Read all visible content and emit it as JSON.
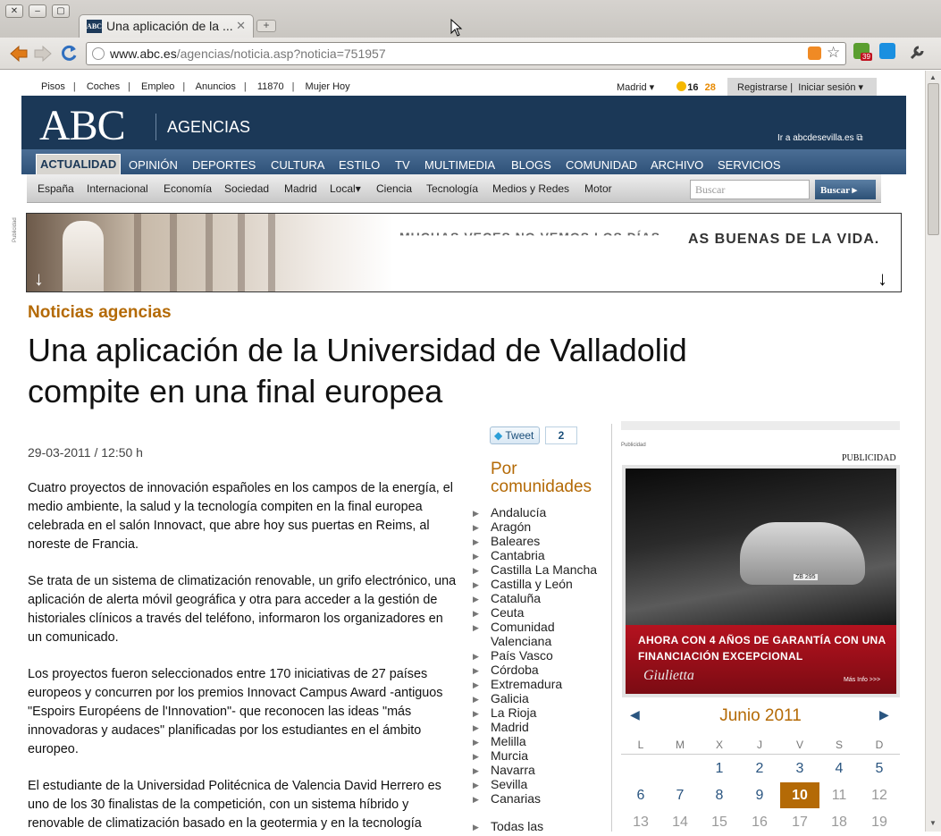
{
  "browser": {
    "tab_title": "Una aplicación de la ...",
    "tab_favicon": "ABC",
    "url_domain": "www.abc.es",
    "url_path": "/agencias/noticia.asp?noticia=751957",
    "extension_badge": "39"
  },
  "topnav": {
    "links": [
      "Pisos",
      "Coches",
      "Empleo",
      "Anuncios",
      "11870",
      "Mujer Hoy"
    ],
    "city": "Madrid ▾",
    "temp_low": "16",
    "temp_high": "28",
    "register": "Registrarse",
    "login": "Iniciar sesión ▾"
  },
  "header": {
    "logo": "ABC",
    "section": "AGENCIAS",
    "sevilla_link": "Ir a abcdesevilla.es"
  },
  "mainnav": {
    "items": [
      "ACTUALIDAD",
      "OPINIÓN",
      "DEPORTES",
      "CULTURA",
      "ESTILO",
      "TV",
      "MULTIMEDIA",
      "BLOGS",
      "COMUNIDAD",
      "ARCHIVO",
      "SERVICIOS"
    ]
  },
  "subnav": {
    "items": [
      "España",
      "Internacional",
      "Economía",
      "Sociedad",
      "Madrid",
      "Local▾",
      "Ciencia",
      "Tecnología",
      "Medios y Redes",
      "Motor"
    ],
    "search_placeholder": "Buscar",
    "search_button": "Buscar ▸"
  },
  "banner": {
    "side_label": "Publicidad",
    "tagline": "AS BUENAS DE LA VIDA.",
    "ghost_text": "MUCHAS VECES NO VEMOS LOS DÍAS"
  },
  "article": {
    "kicker": "Noticias agencias",
    "headline": "Una aplicación de la Universidad de Valladolid compite en una final europea",
    "date": "29-03-2011 / 12:50 h",
    "paragraphs": [
      "Cuatro proyectos de innovación españoles en los campos de la energía, el medio ambiente, la salud y la tecnología compiten en la final europea celebrada en el salón Innovact, que abre hoy sus puertas en Reims, al noreste de Francia.",
      "Se trata de un sistema de climatización renovable, un grifo electrónico, una aplicación de alerta móvil geográfica y otra para acceder a la gestión de historiales clínicos a través del teléfono, informaron los organizadores en un comunicado.",
      "Los proyectos fueron seleccionados entre 170 iniciativas de 27 países europeos y concurren por los premios Innovact Campus Award -antiguos \"Espoirs Européens de l'Innovation\"- que reconocen las ideas \"más innovadoras y audaces\" planificadas por los estudiantes en el ámbito europeo.",
      "El estudiante de la Universidad Politécnica de Valencia David Herrero es uno de los 30 finalistas de la competición, con un sistema híbrido y renovable de climatización basado en la geotermia y en la tecnología"
    ]
  },
  "social": {
    "tweet_label": "Tweet",
    "tweet_count": "2"
  },
  "regions": {
    "title": "Por comunidades",
    "items": [
      "Andalucía",
      "Aragón",
      "Baleares",
      "Cantabria",
      "Castilla La Mancha",
      "Castilla y León",
      "Cataluña",
      "Ceuta",
      "Comunidad",
      "Valenciana",
      "País Vasco",
      "Córdoba",
      "Extremadura",
      "Galicia",
      "La Rioja",
      "Madrid",
      "Melilla",
      "Murcia",
      "Navarra",
      "Sevilla",
      "Canarias"
    ],
    "all": "Todas las"
  },
  "ad": {
    "small_label": "Publicidad",
    "label": "PUBLICIDAD",
    "plate": "ZB 295",
    "line1": "AHORA CON 4 AÑOS DE GARANTÍA CON UNA",
    "line2": "FINANCIACIÓN EXCEPCIONAL",
    "brand": "Giulietta",
    "more": "Más Info >>>"
  },
  "calendar": {
    "month": "Junio 2011",
    "prev": "◀",
    "next": "▶",
    "weekdays": [
      "L",
      "M",
      "X",
      "J",
      "V",
      "S",
      "D"
    ],
    "rows": [
      [
        "",
        "",
        "1",
        "2",
        "3",
        "4",
        "5"
      ],
      [
        "6",
        "7",
        "8",
        "9",
        "10",
        "11",
        "12"
      ],
      [
        "13",
        "14",
        "15",
        "16",
        "17",
        "18",
        "19"
      ]
    ],
    "today": "10"
  },
  "colors": {
    "brand_navy": "#1b3857",
    "accent_orange": "#b46a06",
    "link_blue": "#2a5580"
  }
}
